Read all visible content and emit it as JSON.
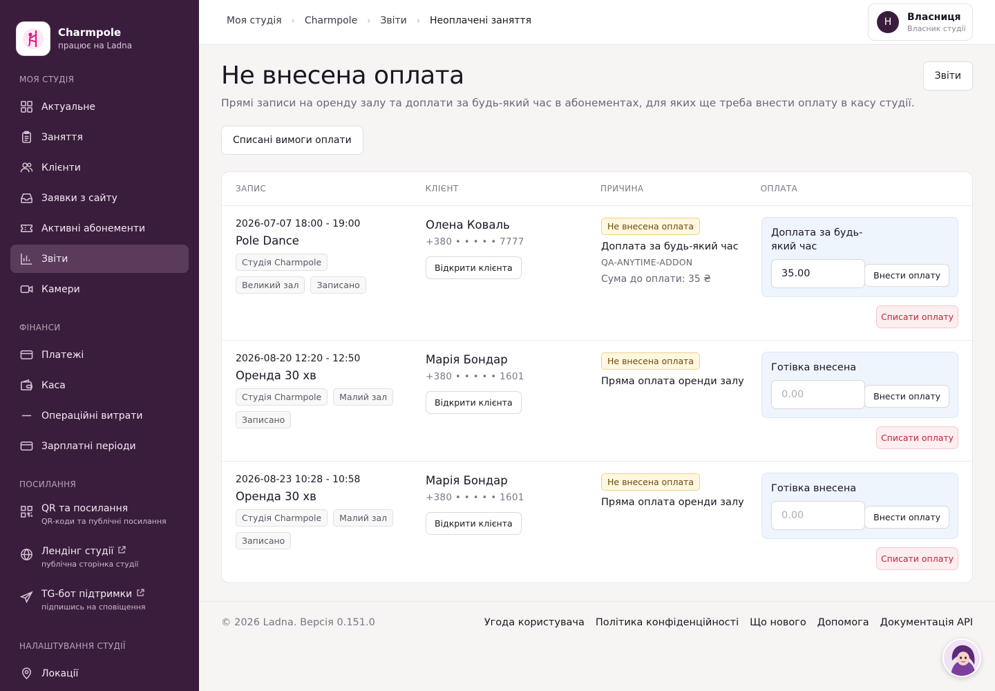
{
  "brand": {
    "name": "Charmpole",
    "sub": "працює на Ladna"
  },
  "sidebar": {
    "sections": [
      {
        "label": "МОЯ СТУДІЯ"
      },
      {
        "label": "ФІНАНСИ"
      },
      {
        "label": "ПОСИЛАННЯ"
      },
      {
        "label": "НАЛАШТУВАННЯ СТУДІЇ"
      }
    ],
    "studio_items": [
      {
        "label": "Актуальне",
        "icon": "dashboard-icon"
      },
      {
        "label": "Заняття",
        "icon": "clipboard-icon"
      },
      {
        "label": "Клієнти",
        "icon": "users-icon"
      },
      {
        "label": "Заявки з сайту",
        "icon": "inbox-icon"
      },
      {
        "label": "Активні абонементи",
        "icon": "ticket-icon"
      },
      {
        "label": "Звіти",
        "icon": "bar-chart-icon",
        "active": true
      },
      {
        "label": "Камери",
        "icon": "video-icon"
      }
    ],
    "finance_items": [
      {
        "label": "Платежі",
        "icon": "credit-card-icon"
      },
      {
        "label": "Каса",
        "icon": "wallet-icon"
      },
      {
        "label": "Операційні витрати",
        "icon": "minus-icon"
      },
      {
        "label": "Зарплатні періоди",
        "icon": "card-icon"
      }
    ],
    "link_items": [
      {
        "label": "QR та посилання",
        "sub": "QR-коди та публічні посилання",
        "icon": "qr-icon"
      },
      {
        "label": "Лендінг студії",
        "sub": "публічна сторінка студії",
        "icon": "globe-icon",
        "external": true
      },
      {
        "label": "TG-бот підтримки",
        "sub": "підпишись на сповіщення",
        "icon": "send-icon",
        "external": true
      }
    ],
    "settings_items": [
      {
        "label": "Локації",
        "icon": "map-pin-icon"
      }
    ]
  },
  "breadcrumbs": [
    "Моя студія",
    "Charmpole",
    "Звіти",
    "Неоплачені заняття"
  ],
  "user": {
    "initial": "Н",
    "name": "Власниця",
    "role": "Власник студії"
  },
  "page": {
    "title": "Не внесена оплата",
    "description": "Прямі записи на оренду залу та доплати за будь-який час в абонементах, для яких ще треба внести оплату в касу студії.",
    "reports_button": "Звіти",
    "writeoffs_button": "Списані вимоги оплати"
  },
  "table": {
    "headers": [
      "Запис",
      "Клієнт",
      "Причина",
      "Оплата"
    ],
    "rows": [
      {
        "time": "2026-07-07 18:00 - 19:00",
        "title": "Pole Dance",
        "tags": [
          "Студія Charmpole",
          "Великий зал",
          "Записано"
        ],
        "client_name": "Олена Коваль",
        "client_phone": "+380 • • • • • 7777",
        "open_client": "Відкрити клієнта",
        "badge": "Не внесена оплата",
        "reason": "Доплата за будь-який час",
        "reason_code": "QA-ANYTIME-ADDON",
        "amount_due": "Сума до оплати: 35 ₴",
        "pay_label": "Доплата за будь-який час",
        "pay_value": "35.00",
        "pay_placeholder": "0.00",
        "pay_button": "Внести оплату",
        "writeoff_button": "Списати оплату"
      },
      {
        "time": "2026-08-20 12:20 - 12:50",
        "title": "Оренда 30 хв",
        "tags": [
          "Студія Charmpole",
          "Малий зал",
          "Записано"
        ],
        "client_name": "Марія Бондар",
        "client_phone": "+380 • • • • • 1601",
        "open_client": "Відкрити клієнта",
        "badge": "Не внесена оплата",
        "reason": "Пряма оплата оренди залу",
        "pay_label": "Готівка внесена",
        "pay_value": "",
        "pay_placeholder": "0.00",
        "pay_button": "Внести оплату",
        "writeoff_button": "Списати оплату"
      },
      {
        "time": "2026-08-23 10:28 - 10:58",
        "title": "Оренда 30 хв",
        "tags": [
          "Студія Charmpole",
          "Малий зал",
          "Записано"
        ],
        "client_name": "Марія Бондар",
        "client_phone": "+380 • • • • • 1601",
        "open_client": "Відкрити клієнта",
        "badge": "Не внесена оплата",
        "reason": "Пряма оплата оренди залу",
        "pay_label": "Готівка внесена",
        "pay_value": "",
        "pay_placeholder": "0.00",
        "pay_button": "Внести оплату",
        "writeoff_button": "Списати оплату"
      }
    ]
  },
  "footer": {
    "copyright": "© 2026 Ladna. Версія 0.151.0",
    "links": [
      "Угода користувача",
      "Політика конфіденційності",
      "Що нового",
      "Допомога",
      "Документація API"
    ]
  },
  "colors": {
    "sidebar_bg": "#3a1d3d",
    "sidebar_active": "#5a3b5c",
    "badge_bg": "#fff7e0",
    "writeoff_text": "#c81e3a",
    "pay_box_bg": "#eef5fc"
  }
}
